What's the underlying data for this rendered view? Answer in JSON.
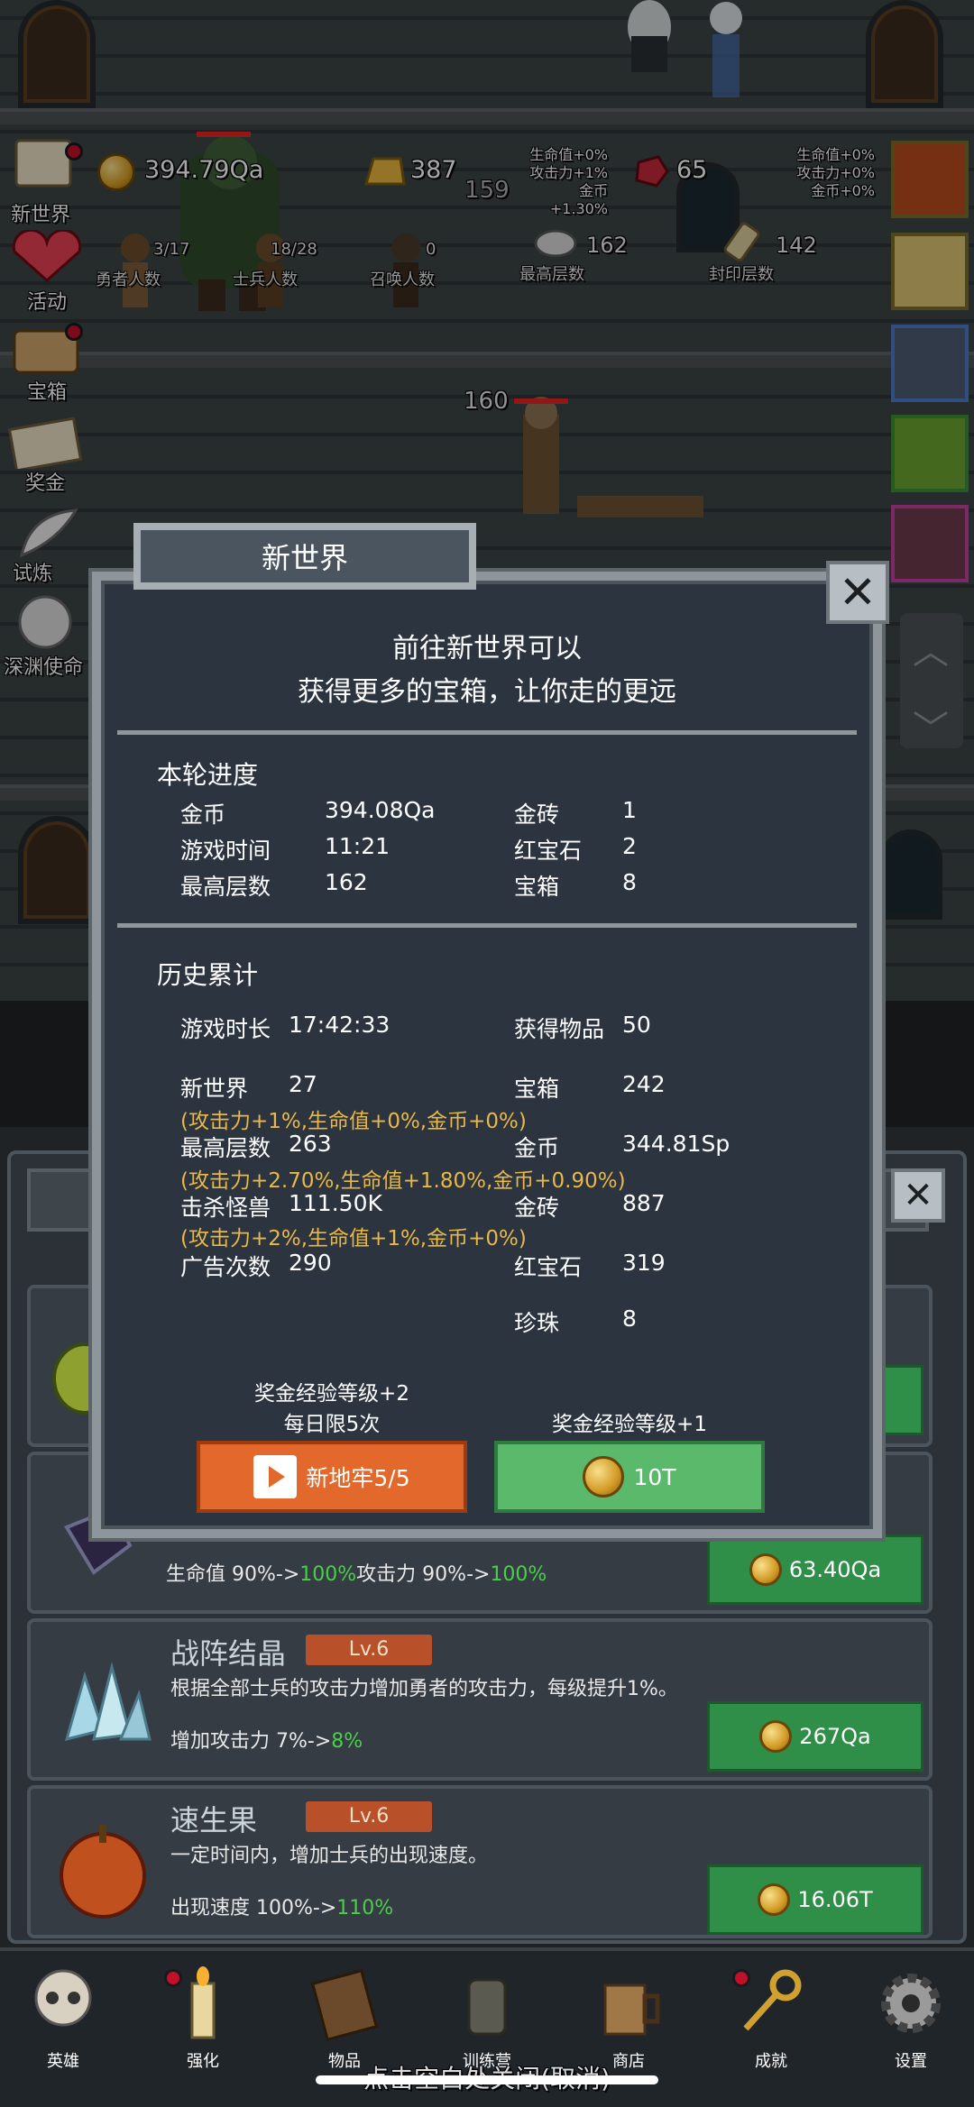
{
  "hud": {
    "gold": "394.79Qa",
    "gold_bricks": "387",
    "rubies": "65",
    "enemy_hp_1": "159",
    "enemy_hp_2": "160",
    "bonus_left": [
      "生命值+0%",
      "攻击力+1%",
      "金币+1.30%"
    ],
    "bonus_right": [
      "生命值+0%",
      "攻击力+0%",
      "金币+0%"
    ],
    "stats": [
      {
        "value": "3/17",
        "label": "勇者人数"
      },
      {
        "value": "18/28",
        "label": "士兵人数"
      },
      {
        "value": "0",
        "label": "召唤人数"
      },
      {
        "value": "162",
        "label": "最高层数"
      },
      {
        "value": "142",
        "label": "封印层数"
      }
    ]
  },
  "side_menu": [
    {
      "label": "新世界",
      "icon": "map-icon",
      "dot": true
    },
    {
      "label": "活动",
      "icon": "heart-icon",
      "dot": false
    },
    {
      "label": "宝箱",
      "icon": "chest-icon",
      "dot": true
    },
    {
      "label": "奖金",
      "icon": "envelope-icon",
      "dot": false
    },
    {
      "label": "试炼",
      "icon": "feather-icon",
      "dot": false
    },
    {
      "label": "深渊使命",
      "icon": "orb-icon",
      "dot": false
    }
  ],
  "modal": {
    "title": "新世界",
    "intro_line1": "前往新世界可以",
    "intro_line2": "获得更多的宝箱，让你走的更远",
    "round_title": "本轮进度",
    "round_left": [
      {
        "label": "金币",
        "value": "394.08Qa"
      },
      {
        "label": "游戏时间",
        "value": "11:21"
      },
      {
        "label": "最高层数",
        "value": "162"
      }
    ],
    "round_right": [
      {
        "label": "金砖",
        "value": "1"
      },
      {
        "label": "红宝石",
        "value": "2"
      },
      {
        "label": "宝箱",
        "value": "8"
      }
    ],
    "history_title": "历史累计",
    "history": {
      "playtime_label": "游戏时长",
      "playtime": "17:42:33",
      "items_label": "获得物品",
      "items": "50",
      "newworld_label": "新世界",
      "newworld": "27",
      "newworld_bonus": "(攻击力+1%,生命值+0%,金币+0%)",
      "chest_label": "宝箱",
      "chest": "242",
      "maxfloor_label": "最高层数",
      "maxfloor": "263",
      "maxfloor_bonus": "(攻击力+2.70%,生命值+1.80%,金币+0.90%)",
      "gold_label": "金币",
      "gold": "344.81Sp",
      "kills_label": "击杀怪兽",
      "kills": "111.50K",
      "kills_bonus": "(攻击力+2%,生命值+1%,金币+0%)",
      "bricks_label": "金砖",
      "bricks": "887",
      "ads_label": "广告次数",
      "ads": "290",
      "ruby_label": "红宝石",
      "ruby": "319",
      "pearl_label": "珍珠",
      "pearl": "8"
    },
    "reward_left_line1": "奖金经验等级+2",
    "reward_left_line2": "每日限5次",
    "reward_right": "奖金经验等级+1",
    "btn_ad": "新地牢5/5",
    "btn_gold": "10T"
  },
  "cards": [
    {
      "stat_prefix": "生命值 90%->",
      "stat_up": "100%",
      "stat_mid": "攻击力 90%->",
      "stat_up2": "100%",
      "price": "63.40Qa"
    },
    {
      "title": "战阵结晶",
      "level": "Lv.6",
      "desc": "根据全部士兵的攻击力增加勇者的攻击力，每级提升1%。",
      "stat_prefix": "增加攻击力 7%->",
      "stat_up": "8%",
      "price": "267Qa"
    },
    {
      "title": "速生果",
      "level": "Lv.6",
      "desc": "一定时间内，增加士兵的出现速度。",
      "stat_prefix": "出现速度 100%->",
      "stat_up": "110%",
      "price": "16.06T"
    }
  ],
  "nav": [
    {
      "label": "英雄",
      "icon": "skull-icon",
      "dot": false
    },
    {
      "label": "强化",
      "icon": "candle-icon",
      "dot": true
    },
    {
      "label": "物品",
      "icon": "book-icon",
      "dot": false
    },
    {
      "label": "训练营",
      "icon": "lantern-icon",
      "dot": false
    },
    {
      "label": "商店",
      "icon": "mug-icon",
      "dot": false
    },
    {
      "label": "成就",
      "icon": "key-icon",
      "dot": true
    },
    {
      "label": "设置",
      "icon": "gear-icon",
      "dot": false
    }
  ],
  "hint": "点击空白处关闭(取消)",
  "colors": {
    "accent_orange": "#e2682b",
    "accent_green": "#5bb96b",
    "bonus_gold": "#e7b84a",
    "up_green": "#4ccd4c"
  }
}
